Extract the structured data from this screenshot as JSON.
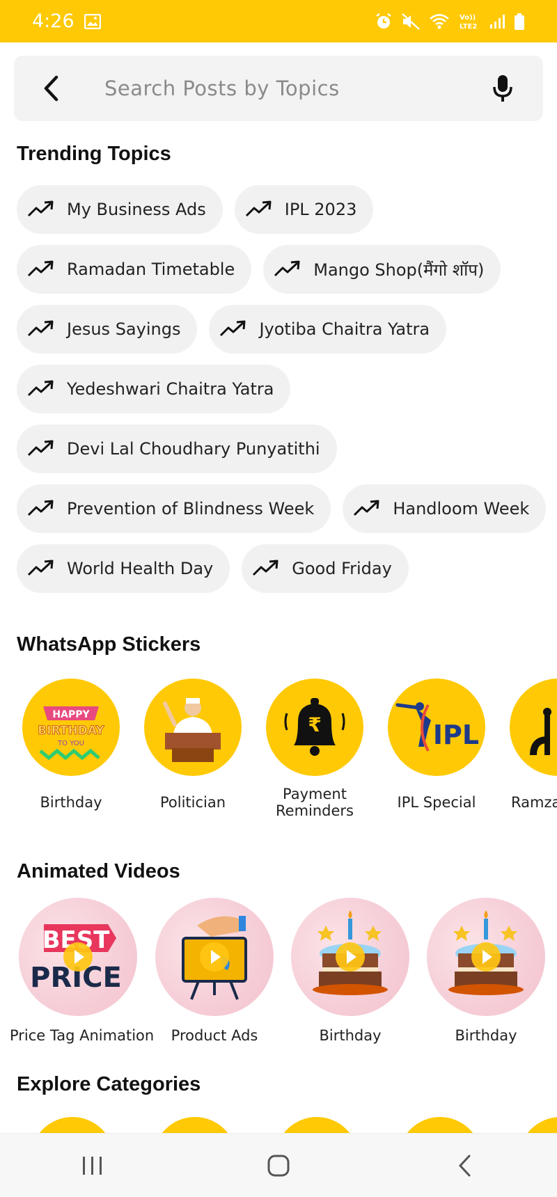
{
  "status_bar": {
    "time": "4:26",
    "icons": [
      "image-icon",
      "alarm-icon",
      "mute-icon",
      "wifi-icon",
      "volte-icon",
      "signal-icon",
      "battery-icon"
    ],
    "network_label": "Vo))\nLTE2",
    "color": "#FFC905"
  },
  "search": {
    "placeholder": "Search Posts by Topics",
    "value": ""
  },
  "trending": {
    "title": "Trending Topics",
    "chips": [
      "My Business Ads",
      "IPL 2023",
      "Ramadan Timetable",
      "Mango Shop(मैंगो शॉप)",
      "Jesus Sayings",
      "Jyotiba Chaitra Yatra",
      "Yedeshwari Chaitra Yatra",
      "Devi Lal Choudhary Punyatithi",
      "Prevention of Blindness Week",
      "Handloom Week",
      "World Health Day",
      "Good Friday"
    ]
  },
  "stickers": {
    "title": "WhatsApp Stickers",
    "items": [
      {
        "label": "Birthday",
        "icon": "birthday-banner-icon"
      },
      {
        "label": "Politician",
        "icon": "politician-icon"
      },
      {
        "label": "Payment Reminders",
        "icon": "payment-bell-icon"
      },
      {
        "label": "IPL Special",
        "icon": "ipl-icon"
      },
      {
        "label": "Ramza",
        "icon": "mosque-icon"
      }
    ]
  },
  "videos": {
    "title": "Animated Videos",
    "items": [
      {
        "label": "Price Tag Animation",
        "icon": "best-price-icon",
        "art_text_1": "BEST",
        "art_text_2": "PRICE"
      },
      {
        "label": "Product Ads",
        "icon": "product-presentation-icon"
      },
      {
        "label": "Birthday",
        "icon": "birthday-cake-icon"
      },
      {
        "label": "Birthday",
        "icon": "birthday-cake-icon"
      }
    ]
  },
  "explore": {
    "title": "Explore Categories"
  },
  "sticker_art": {
    "birthday_1": "HAPPY",
    "birthday_2": "BIRTHDAY",
    "birthday_3": "TO YOU",
    "ipl": "IPL",
    "rupee": "₹"
  },
  "colors": {
    "accent": "#FFC905",
    "chip_bg": "#f1f1f1",
    "search_bg": "#f3f3f3"
  }
}
